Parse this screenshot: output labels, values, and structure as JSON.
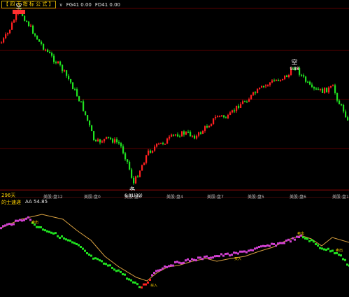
{
  "header": {
    "formula_name": "【 四 无 指 标 公 式 】",
    "fg41_label": "FG41 0.00",
    "fd41_label": "FD41 0.00"
  },
  "days_label": "296天",
  "sub_indicator": {
    "name": "的士速递",
    "aa_label": "AA 54.85"
  },
  "markers": {
    "sell": "空",
    "buy": "多",
    "sell_mini": "卖出",
    "buy_mini": "买入"
  },
  "axis_labels": [
    "美股:盘12",
    "美股:盘0",
    "美股:盘6",
    "美股:盘4",
    "美股:盘7",
    "美股:盘5",
    "美股:盘6",
    "美股:盘1",
    "美股:盘6",
    "美股:盘7"
  ],
  "low_price_label": "6.01(39)",
  "high_price_label": "9.88",
  "colors": {
    "up": "#ff2020",
    "down": "#20e020",
    "grid": "#5a0000",
    "line": "#d8a040",
    "purple": "#d040d0",
    "accent": "#ffd200"
  }
}
